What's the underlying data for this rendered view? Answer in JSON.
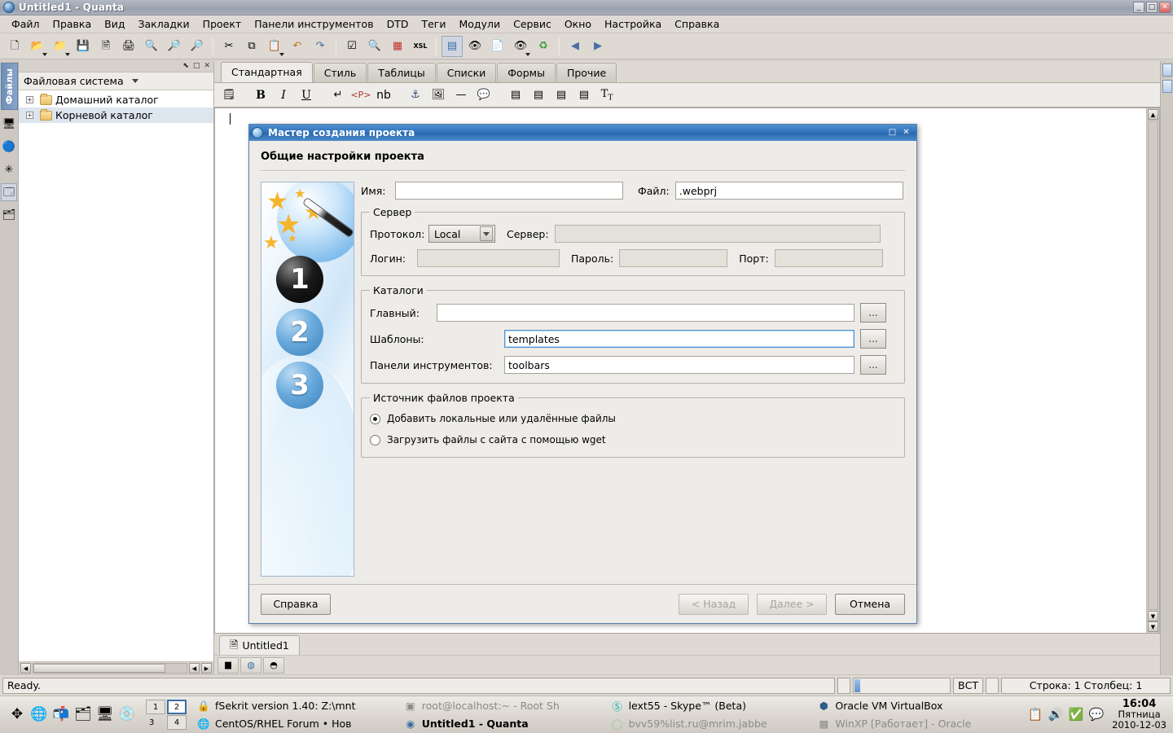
{
  "window": {
    "title": "Untitled1 - Quanta",
    "icon": "quanta-icon",
    "buttons": {
      "minimize": "_",
      "maximize": "□",
      "close": "✕"
    }
  },
  "menubar": {
    "items": [
      {
        "label": "Файл",
        "accel": "Ф"
      },
      {
        "label": "Правка",
        "accel": "П"
      },
      {
        "label": "Вид",
        "accel": "В"
      },
      {
        "label": "Закладки",
        "accel": "З"
      },
      {
        "label": "Проект",
        "accel": "П"
      },
      {
        "label": "Панели инструментов",
        "accel": "и"
      },
      {
        "label": "DTD",
        "accel": "D"
      },
      {
        "label": "Теги",
        "accel": "Т"
      },
      {
        "label": "Модули",
        "accel": "М"
      },
      {
        "label": "Сервис",
        "accel": "С"
      },
      {
        "label": "Окно",
        "accel": "О"
      },
      {
        "label": "Настройка",
        "accel": "Н"
      },
      {
        "label": "Справка",
        "accel": "С"
      }
    ]
  },
  "main_toolbar": {
    "buttons": [
      {
        "name": "new-file-icon",
        "glyph": "🗋"
      },
      {
        "name": "open-file-icon",
        "glyph": "📂"
      },
      {
        "name": "open-project-icon",
        "glyph": "📁"
      },
      {
        "name": "save-icon",
        "glyph": "💾"
      },
      {
        "name": "save-all-icon",
        "glyph": "🗎"
      },
      {
        "name": "print-icon",
        "glyph": "🖨"
      },
      {
        "name": "print-preview-icon",
        "glyph": "🔍"
      },
      {
        "name": "zoom-in-icon",
        "glyph": "🔎"
      },
      {
        "name": "zoom-out-icon",
        "glyph": "🔎"
      },
      {
        "name": "cut-icon",
        "glyph": "✂"
      },
      {
        "name": "copy-icon",
        "glyph": "⧉"
      },
      {
        "name": "paste-icon",
        "glyph": "📋"
      },
      {
        "name": "undo-icon",
        "glyph": "↶"
      },
      {
        "name": "redo-icon",
        "glyph": "↷"
      },
      {
        "name": "spellcheck-icon",
        "glyph": "☑"
      },
      {
        "name": "find-icon",
        "glyph": "🔍"
      },
      {
        "name": "tags-icon",
        "glyph": "▦"
      },
      {
        "name": "xsl-icon",
        "glyph": "XSL"
      },
      {
        "name": "view-source-icon",
        "glyph": "▤"
      },
      {
        "name": "preview-icon",
        "glyph": "👁"
      },
      {
        "name": "view-document-icon",
        "glyph": "📄"
      },
      {
        "name": "preview-browser-icon",
        "glyph": "👁"
      },
      {
        "name": "reload-icon",
        "glyph": "♻"
      },
      {
        "name": "back-icon",
        "glyph": "◀"
      },
      {
        "name": "forward-icon",
        "glyph": "▶"
      }
    ]
  },
  "left_dock": {
    "vertical_tab": "Файлы",
    "icons": [
      {
        "name": "files-tree-icon"
      },
      {
        "name": "project-icon"
      },
      {
        "name": "templates-icon"
      },
      {
        "name": "structure-icon"
      },
      {
        "name": "scripts-icon"
      }
    ]
  },
  "file_panel": {
    "caption_buttons": [
      "⬉",
      "□",
      "✕"
    ],
    "header": "Файловая система",
    "tree": [
      {
        "label": "Домашний каталог",
        "expander": "+",
        "selected": false
      },
      {
        "label": "Корневой каталог",
        "expander": "+",
        "selected": true
      }
    ]
  },
  "editor": {
    "tag_tabs": [
      {
        "label": "Стандартная",
        "selected": true
      },
      {
        "label": "Стиль",
        "selected": false
      },
      {
        "label": "Таблицы",
        "selected": false
      },
      {
        "label": "Списки",
        "selected": false
      },
      {
        "label": "Формы",
        "selected": false
      },
      {
        "label": "Прочие",
        "selected": false
      }
    ],
    "format_toolbar": [
      {
        "name": "quick-start-icon",
        "glyph": "🗒"
      },
      {
        "name": "bold-icon",
        "glyph": "B"
      },
      {
        "name": "italic-icon",
        "glyph": "I"
      },
      {
        "name": "underline-icon",
        "glyph": "U"
      },
      {
        "name": "line-break-icon",
        "glyph": "↵"
      },
      {
        "name": "paragraph-icon",
        "glyph": "⟨P⟩"
      },
      {
        "name": "nonbreaking-space-icon",
        "glyph": "nb"
      },
      {
        "name": "anchor-icon",
        "glyph": "⚓"
      },
      {
        "name": "image-icon",
        "glyph": "🖼"
      },
      {
        "name": "horizontal-rule-icon",
        "glyph": "—"
      },
      {
        "name": "comment-icon",
        "glyph": "💬"
      },
      {
        "name": "align-left-icon",
        "glyph": "▤"
      },
      {
        "name": "align-center-icon",
        "glyph": "▤"
      },
      {
        "name": "align-right-icon",
        "glyph": "▤"
      },
      {
        "name": "align-justify-icon",
        "glyph": "▤"
      },
      {
        "name": "font-icon",
        "glyph": "T"
      }
    ],
    "document_tabs": [
      {
        "label": "Untitled1",
        "icon": "document-icon",
        "selected": true
      }
    ],
    "bottom_icons": [
      {
        "name": "terminal-icon",
        "glyph": "▆"
      },
      {
        "name": "documentation-icon",
        "glyph": "◍"
      },
      {
        "name": "preview-pane-icon",
        "glyph": "◓"
      }
    ]
  },
  "statusbar": {
    "message": "Ready.",
    "insert_mode": "ВСТ",
    "cursor_position": "Строка: 1 Столбец: 1"
  },
  "dialog": {
    "title": "Мастер создания проекта",
    "icon": "quanta-icon",
    "buttons": {
      "maximize": "□",
      "close": "✕"
    },
    "heading": "Общие настройки проекта",
    "wizard_steps": [
      "1",
      "2",
      "3"
    ],
    "name_label": "Имя:",
    "name_value": "",
    "file_label": "Файл:",
    "file_value": ".webprj",
    "server": {
      "legend": "Сервер",
      "protocol_label": "Протокол:",
      "protocol_value": "Local",
      "protocol_options": [
        "Local"
      ],
      "server_label": "Сервер:",
      "server_value": "",
      "login_label": "Логин:",
      "login_value": "",
      "password_label": "Пароль:",
      "password_value": "",
      "port_label": "Порт:",
      "port_value": ""
    },
    "directories": {
      "legend": "Каталоги",
      "main_label": "Главный:",
      "main_value": "",
      "templates_label": "Шаблоны:",
      "templates_value": "templates",
      "toolbars_label": "Панели инструментов:",
      "toolbars_value": "toolbars",
      "browse_label": "..."
    },
    "source": {
      "legend": "Источник файлов проекта",
      "options": [
        {
          "label": "Добавить локальные или удалённые файлы",
          "selected": true
        },
        {
          "label": "Загрузить файлы с сайта с помощью wget",
          "selected": false
        }
      ]
    },
    "footer": {
      "help": "Справка",
      "back": "< Назад",
      "next": "Далее >",
      "cancel": "Отмена",
      "back_disabled": true,
      "next_disabled": true
    }
  },
  "taskbar": {
    "quicklaunch": [
      {
        "name": "show-desktop-icon"
      },
      {
        "name": "browser-icon"
      },
      {
        "name": "mail-icon"
      },
      {
        "name": "files-icon"
      },
      {
        "name": "display-icon"
      },
      {
        "name": "media-icon"
      }
    ],
    "pager": [
      {
        "label": "1",
        "current": false
      },
      {
        "label": "2",
        "current": true
      },
      {
        "label": "3",
        "current": false
      },
      {
        "label": "4",
        "current": false
      }
    ],
    "tasks": [
      {
        "label": "fSekrit version 1.40: Z:\\mnt",
        "icon": "lock-icon",
        "active": false,
        "dim": false
      },
      {
        "label": "root@localhost:~ - Root Sh",
        "icon": "terminal-icon",
        "active": false,
        "dim": true
      },
      {
        "label": "lext55 - Skype™ (Beta)",
        "icon": "skype-icon",
        "active": false,
        "dim": false
      },
      {
        "label": "Oracle VM VirtualBox",
        "icon": "virtualbox-icon",
        "active": false,
        "dim": false
      },
      {
        "label": "CentOS/RHEL Forum • Нов",
        "icon": "firefox-icon",
        "active": false,
        "dim": false
      },
      {
        "label": "Untitled1 - Quanta",
        "icon": "quanta-icon",
        "active": true,
        "dim": false
      },
      {
        "label": "bvv59%list.ru@mrim.jabbe",
        "icon": "jabber-icon",
        "active": false,
        "dim": true
      },
      {
        "label": "WinXP [Работает] - Oracle",
        "icon": "winxp-icon",
        "active": false,
        "dim": true
      }
    ],
    "tray": [
      {
        "name": "clipboard-icon"
      },
      {
        "name": "volume-icon"
      },
      {
        "name": "updates-icon"
      },
      {
        "name": "messenger-icon"
      }
    ],
    "clock": {
      "time": "16:04",
      "weekday": "Пятница",
      "date": "2010-12-03"
    }
  }
}
